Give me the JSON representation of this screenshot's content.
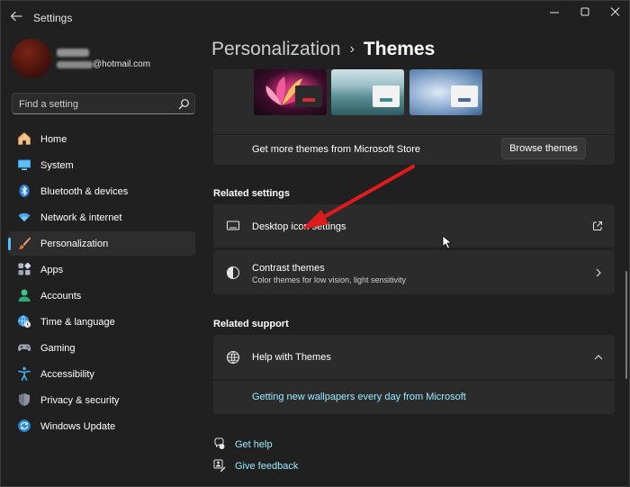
{
  "window": {
    "title": "Settings",
    "controls": [
      "minimize-icon",
      "maximize-icon",
      "close-icon"
    ]
  },
  "profile": {
    "email_suffix": "@hotmail.com"
  },
  "search": {
    "placeholder": "Find a setting",
    "icon": "search-icon"
  },
  "sidebar": {
    "items": [
      {
        "label": "Home",
        "icon": "home-icon"
      },
      {
        "label": "System",
        "icon": "system-icon"
      },
      {
        "label": "Bluetooth & devices",
        "icon": "bluetooth-icon"
      },
      {
        "label": "Network & internet",
        "icon": "wifi-icon"
      },
      {
        "label": "Personalization",
        "icon": "brush-icon",
        "active": true
      },
      {
        "label": "Apps",
        "icon": "apps-icon"
      },
      {
        "label": "Accounts",
        "icon": "accounts-icon"
      },
      {
        "label": "Time & language",
        "icon": "globe-clock-icon"
      },
      {
        "label": "Gaming",
        "icon": "gamepad-icon"
      },
      {
        "label": "Accessibility",
        "icon": "accessibility-icon"
      },
      {
        "label": "Privacy & security",
        "icon": "shield-icon"
      },
      {
        "label": "Windows Update",
        "icon": "update-icon"
      }
    ]
  },
  "breadcrumb": {
    "parent": "Personalization",
    "separator": "›",
    "current": "Themes"
  },
  "themes": {
    "store_text": "Get more themes from Microsoft Store",
    "browse_button": "Browse themes"
  },
  "related_settings": {
    "title": "Related settings",
    "items": [
      {
        "title": "Desktop icon settings",
        "icon": "monitor-icon",
        "end_icon": "open-external-icon"
      },
      {
        "title": "Contrast themes",
        "subtitle": "Color themes for low vision, light sensitivity",
        "icon": "contrast-icon",
        "end_icon": "chevron-right-icon"
      }
    ]
  },
  "related_support": {
    "title": "Related support",
    "help_title": "Help with Themes",
    "help_link": "Getting new wallpapers every day from Microsoft"
  },
  "footer": {
    "get_help": "Get help",
    "give_feedback": "Give feedback"
  },
  "colors": {
    "accent": "#4cc2ff",
    "link": "#99ebff",
    "annotation_arrow": "#e01b1b",
    "background": "#202020",
    "card": "#2b2b2b"
  }
}
